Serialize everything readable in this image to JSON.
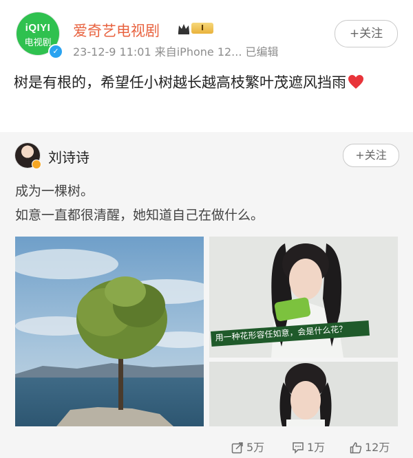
{
  "header": {
    "avatar_brand": "iQIYI",
    "avatar_sub": "电视剧",
    "account_name": "爱奇艺电视剧",
    "level": "I",
    "meta": "23-12-9 11:01  来自iPhone 12...  已编辑",
    "follow_label": "+关注"
  },
  "post": {
    "text": "树是有根的，希望任小树越长越高枝繁叶茂遮风挡雨"
  },
  "repost": {
    "author": "刘诗诗",
    "follow_label": "+关注",
    "line1": "成为一棵树。",
    "line2": "如意一直都很清醒，她知道自己在做什么。",
    "image_caption": "用一种花形容任如意，会是什么花？"
  },
  "actions": {
    "repost_count": "5万",
    "comment_count": "1万",
    "like_count": "12万"
  },
  "colors": {
    "accent": "#e8623f",
    "iqiyi_green": "#2fc14f",
    "verified_blue": "#2aa3f0"
  }
}
